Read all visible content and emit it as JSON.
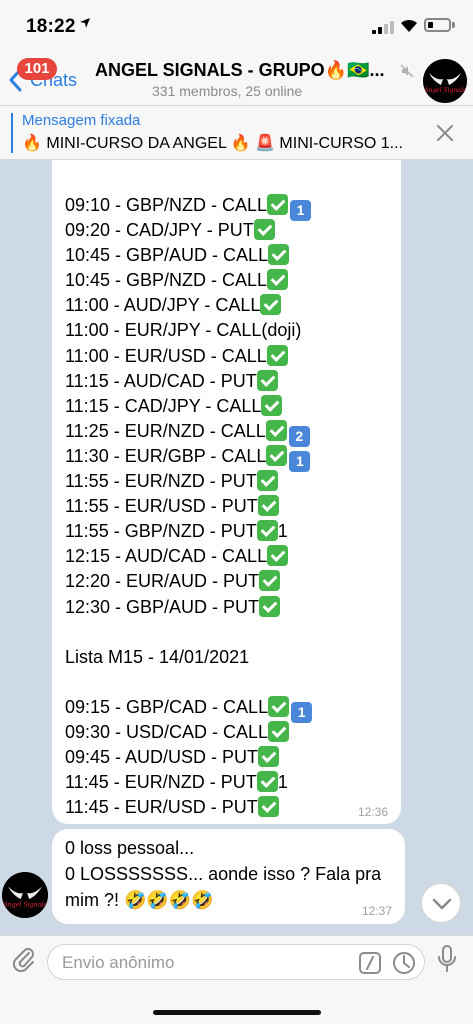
{
  "status_bar": {
    "time": "18:22",
    "location_icon": "location-arrow-icon"
  },
  "header": {
    "back_label": "Chats",
    "unread_count": "101",
    "title": "ANGEL SIGNALS - GRUPO🔥🇧🇷...",
    "subtitle": "331 membros, 25 online",
    "avatar_icon": "angel-signals-logo",
    "avatar_text": "Angel Signals"
  },
  "pinned": {
    "title": "Mensagem fixada",
    "text": "🔥 MINI-CURSO DA ANGEL 🔥 🚨 MINI-CURSO 1..."
  },
  "messages": [
    {
      "lines": [
        {
          "text": "09:10 - GBP/NZD - CALL",
          "check": true,
          "suffix_key": "1"
        },
        {
          "text": "09:20 - CAD/JPY - PUT",
          "check": true
        },
        {
          "text": "10:45 - GBP/AUD - CALL",
          "check": true
        },
        {
          "text": "10:45 - GBP/NZD - CALL",
          "check": true
        },
        {
          "text": "11:00 - AUD/JPY - CALL",
          "check": true
        },
        {
          "text": "11:00 - EUR/JPY - CALL(doji)",
          "check": false
        },
        {
          "text": "11:00 - EUR/USD - CALL",
          "check": true
        },
        {
          "text": "11:15 - AUD/CAD - PUT",
          "check": true
        },
        {
          "text": "11:15 - CAD/JPY - CALL",
          "check": true
        },
        {
          "text": "11:25 - EUR/NZD - CALL",
          "check": true,
          "suffix_key": "2"
        },
        {
          "text": "11:30 - EUR/GBP - CALL",
          "check": true,
          "suffix_key": "1"
        },
        {
          "text": "11:55 - EUR/NZD - PUT",
          "check": true
        },
        {
          "text": "11:55 - EUR/USD - PUT",
          "check": true
        },
        {
          "text": "11:55 - GBP/NZD - PUT",
          "check": true,
          "suffix_text": "1"
        },
        {
          "text": "12:15 - AUD/CAD - CALL",
          "check": true
        },
        {
          "text": "12:20 - EUR/AUD - PUT",
          "check": true
        },
        {
          "text": "12:30 - GBP/AUD - PUT",
          "check": true
        },
        {
          "text": "",
          "check": false
        },
        {
          "text": "Lista M15 - 14/01/2021",
          "check": false
        },
        {
          "text": "",
          "check": false
        },
        {
          "text": "09:15 - GBP/CAD - CALL",
          "check": true,
          "suffix_key": "1"
        },
        {
          "text": "09:30 - USD/CAD - CALL",
          "check": true
        },
        {
          "text": "09:45 - AUD/USD - PUT",
          "check": true
        },
        {
          "text": "11:45 - EUR/NZD - PUT",
          "check": true,
          "suffix_text": "1"
        },
        {
          "text": "11:45 - EUR/USD - PUT",
          "check": true
        }
      ],
      "time": "12:36"
    },
    {
      "lines": [
        {
          "text": "0 loss pessoal..."
        },
        {
          "text": "0 LOSSSSSSS... aonde isso ? Fala pra"
        },
        {
          "text": "mim ?! 🤣🤣🤣🤣"
        }
      ],
      "time": "12:37"
    }
  ],
  "input": {
    "placeholder": "Envio anônimo"
  },
  "icons": {
    "attach": "paperclip-icon",
    "commands": "slash-command-icon",
    "schedule": "clock-icon",
    "mic": "microphone-icon",
    "scroll": "chevron-down-icon",
    "close": "close-icon",
    "mute": "mute-icon"
  },
  "colors": {
    "accent": "#2c7ee0",
    "badge": "#e8453c",
    "check": "#45b649",
    "keycap": "#4a87d8"
  }
}
